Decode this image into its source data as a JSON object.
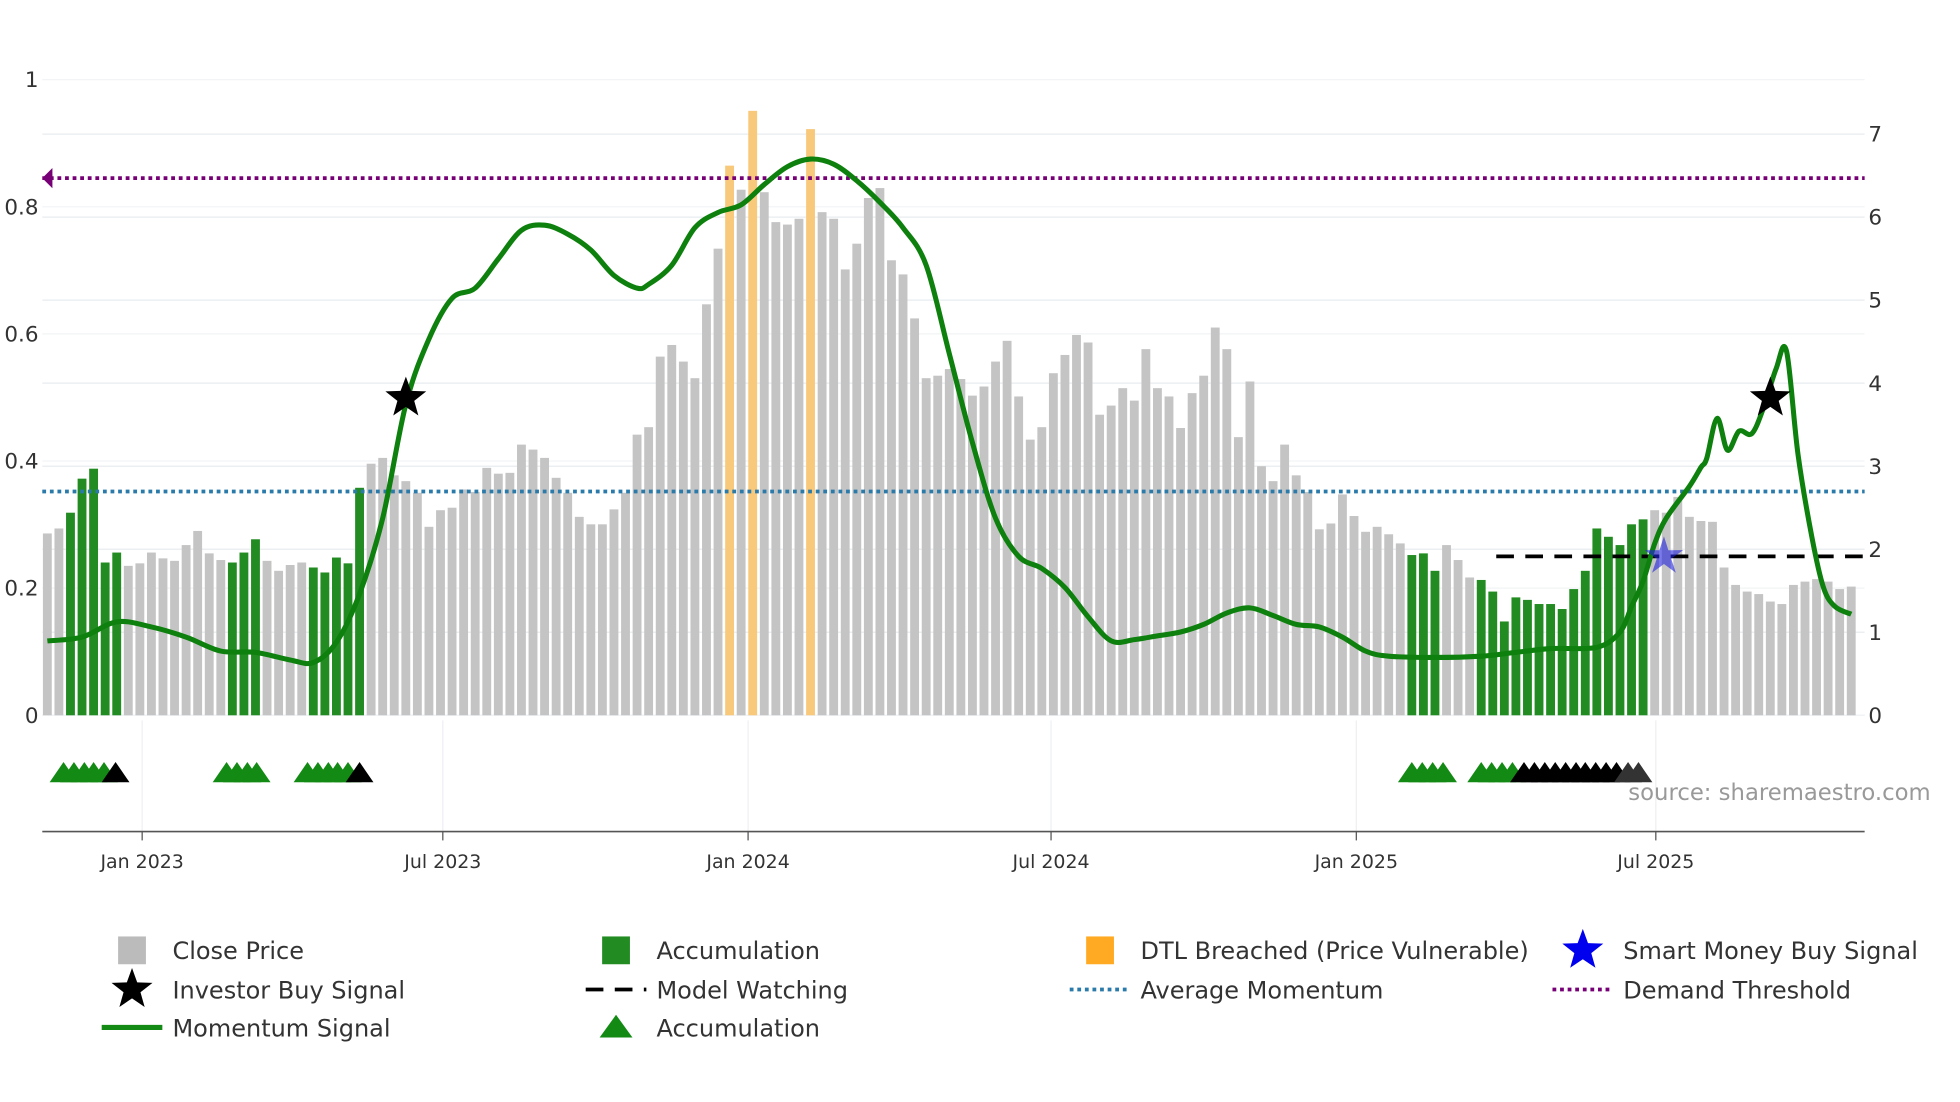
{
  "chart_data": {
    "type": "bar",
    "title": "",
    "x_unit": "week index (weekly bars, Nov 2022 – Nov 2025)",
    "x_ticks": [
      {
        "label": "Jan 2023",
        "week": 8.2
      },
      {
        "label": "Jul 2023",
        "week": 34.2
      },
      {
        "label": "Jan 2024",
        "week": 60.6
      },
      {
        "label": "Jul 2024",
        "week": 86.8
      },
      {
        "label": "Jan 2025",
        "week": 113.2
      },
      {
        "label": "Jul 2025",
        "week": 139.1
      }
    ],
    "left_axis": {
      "range": [
        0,
        1
      ],
      "ticks": [
        "0",
        "0.2",
        "0.4",
        "0.6",
        "0.8",
        "1"
      ],
      "values": [
        0,
        0.2,
        0.4,
        0.6,
        0.8,
        1
      ]
    },
    "right_axis": {
      "range": [
        0,
        7.65
      ],
      "ticks": [
        "0",
        "1",
        "2",
        "3",
        "4",
        "5",
        "6",
        "7"
      ],
      "values": [
        0,
        1,
        2,
        3,
        4,
        5,
        6,
        7
      ]
    },
    "close_price": [
      2.19,
      2.25,
      2.44,
      2.85,
      2.97,
      1.84,
      1.96,
      1.8,
      1.83,
      1.96,
      1.89,
      1.86,
      2.05,
      2.22,
      1.95,
      1.87,
      1.84,
      1.96,
      2.12,
      1.86,
      1.74,
      1.81,
      1.84,
      1.78,
      1.72,
      1.9,
      1.83,
      2.74,
      3.03,
      3.1,
      2.89,
      2.82,
      2.68,
      2.27,
      2.47,
      2.5,
      2.72,
      2.69,
      2.98,
      2.91,
      2.92,
      3.26,
      3.2,
      3.1,
      2.86,
      2.68,
      2.39,
      2.3,
      2.3,
      2.48,
      2.68,
      3.38,
      3.47,
      4.32,
      4.46,
      4.26,
      4.06,
      4.95,
      5.62,
      6.62,
      6.33,
      7.28,
      6.3,
      5.94,
      5.91,
      5.98,
      7.06,
      6.06,
      5.98,
      5.37,
      5.68,
      6.23,
      6.35,
      5.48,
      5.31,
      4.78,
      4.06,
      4.09,
      4.17,
      4.05,
      3.85,
      3.96,
      4.26,
      4.51,
      3.84,
      3.32,
      3.47,
      4.12,
      4.34,
      4.58,
      4.49,
      3.62,
      3.73,
      3.94,
      3.79,
      4.41,
      3.94,
      3.84,
      3.46,
      3.88,
      4.09,
      4.67,
      4.41,
      3.35,
      4.02,
      3.0,
      2.82,
      3.26,
      2.89,
      2.69,
      2.24,
      2.31,
      2.66,
      2.4,
      2.21,
      2.27,
      2.18,
      2.07,
      1.93,
      1.95,
      1.74,
      2.05,
      1.87,
      1.66,
      1.63,
      1.49,
      1.13,
      1.42,
      1.39,
      1.34,
      1.34,
      1.28,
      1.52,
      1.74,
      2.25,
      2.15,
      2.05,
      2.3,
      2.36,
      2.47,
      2.44,
      2.63,
      2.39,
      2.34,
      2.33,
      1.78,
      1.57,
      1.49,
      1.46,
      1.37,
      1.34,
      1.57,
      1.61,
      1.64,
      1.61,
      1.52,
      1.55
    ],
    "accumulation_weeks": [
      2,
      3,
      4,
      5,
      6,
      16,
      17,
      18,
      23,
      24,
      25,
      26,
      27,
      118,
      119,
      120,
      124,
      125,
      126,
      127,
      128,
      129,
      130,
      131,
      132,
      133,
      134,
      135,
      136,
      137,
      138
    ],
    "dtl_breached_weeks": [
      59,
      61,
      66
    ],
    "momentum_signal": [
      [
        0,
        0.117
      ],
      [
        3,
        0.123
      ],
      [
        6,
        0.147
      ],
      [
        9,
        0.139
      ],
      [
        12,
        0.123
      ],
      [
        15,
        0.101
      ],
      [
        18,
        0.099
      ],
      [
        21,
        0.087
      ],
      [
        23,
        0.083
      ],
      [
        25,
        0.115
      ],
      [
        27,
        0.191
      ],
      [
        29,
        0.31
      ],
      [
        31,
        0.489
      ],
      [
        33,
        0.592
      ],
      [
        35,
        0.656
      ],
      [
        37,
        0.672
      ],
      [
        39,
        0.718
      ],
      [
        41,
        0.763
      ],
      [
        43,
        0.771
      ],
      [
        45,
        0.757
      ],
      [
        47,
        0.732
      ],
      [
        49,
        0.692
      ],
      [
        51,
        0.672
      ],
      [
        52,
        0.678
      ],
      [
        54,
        0.708
      ],
      [
        56,
        0.767
      ],
      [
        58,
        0.791
      ],
      [
        60,
        0.803
      ],
      [
        62,
        0.835
      ],
      [
        64,
        0.863
      ],
      [
        66,
        0.875
      ],
      [
        68,
        0.867
      ],
      [
        70,
        0.841
      ],
      [
        72,
        0.807
      ],
      [
        74,
        0.767
      ],
      [
        76,
        0.708
      ],
      [
        78,
        0.569
      ],
      [
        80,
        0.429
      ],
      [
        82,
        0.31
      ],
      [
        84,
        0.25
      ],
      [
        86,
        0.231
      ],
      [
        88,
        0.201
      ],
      [
        90,
        0.155
      ],
      [
        92,
        0.117
      ],
      [
        94,
        0.119
      ],
      [
        96,
        0.125
      ],
      [
        98,
        0.131
      ],
      [
        100,
        0.143
      ],
      [
        102,
        0.161
      ],
      [
        104,
        0.169
      ],
      [
        106,
        0.157
      ],
      [
        108,
        0.143
      ],
      [
        110,
        0.139
      ],
      [
        112,
        0.123
      ],
      [
        114,
        0.101
      ],
      [
        116,
        0.093
      ],
      [
        120,
        0.091
      ],
      [
        124,
        0.093
      ],
      [
        127,
        0.099
      ],
      [
        130,
        0.105
      ],
      [
        134,
        0.107
      ],
      [
        136,
        0.131
      ],
      [
        137,
        0.171
      ],
      [
        138,
        0.211
      ],
      [
        139,
        0.27
      ],
      [
        140,
        0.31
      ],
      [
        142,
        0.36
      ],
      [
        143,
        0.39
      ],
      [
        143.5,
        0.404
      ],
      [
        144.4,
        0.467
      ],
      [
        145.3,
        0.417
      ],
      [
        146.3,
        0.447
      ],
      [
        147.4,
        0.443
      ],
      [
        148.4,
        0.483
      ],
      [
        149.5,
        0.545
      ],
      [
        150.4,
        0.573
      ],
      [
        151.4,
        0.41
      ],
      [
        152.6,
        0.28
      ],
      [
        153.6,
        0.201
      ],
      [
        154.6,
        0.171
      ],
      [
        156,
        0.159
      ]
    ],
    "average_momentum": 0.352,
    "demand_threshold": 0.845,
    "model_watching": {
      "from_week": 125.3,
      "value": 0.25
    },
    "investor_buy_signals": [
      [
        31,
        0.499
      ],
      [
        149,
        0.499
      ]
    ],
    "smart_money_buy_signals": [
      [
        139.8,
        0.25
      ]
    ],
    "accumulation_markers": {
      "green": [
        1.4,
        2.3,
        3.2,
        4.0,
        4.9,
        15.5,
        16.4,
        17.3,
        18.1,
        22.5,
        23.4,
        24.3,
        25.1,
        26.0,
        118.0,
        118.9,
        119.8,
        120.7,
        124.0,
        124.9,
        125.8,
        126.7
      ],
      "black": [
        5.9,
        27.0,
        127.7,
        128.6,
        129.5,
        130.4,
        131.3,
        132.2,
        133.0,
        133.9,
        134.8,
        135.7
      ],
      "gray": [
        136.7,
        137.6
      ]
    },
    "source": "source: sharemaestro.com",
    "legend_placement": "bottom",
    "legend": [
      {
        "label": "Close Price",
        "symbol": "bar",
        "color": "#bbbbbb"
      },
      {
        "label": "Investor Buy Signal",
        "symbol": "star",
        "color": "#000000"
      },
      {
        "label": "Momentum Signal",
        "symbol": "line",
        "color": "#138a13"
      },
      {
        "label": "Accumulation",
        "symbol": "bar",
        "color": "#228b22"
      },
      {
        "label": "Model Watching",
        "symbol": "dash",
        "color": "#000000"
      },
      {
        "label": "Accumulation",
        "symbol": "triangle",
        "color": "#138a13"
      },
      {
        "label": "DTL Breached (Price Vulnerable)",
        "symbol": "bar",
        "color": "#ffaa22"
      },
      {
        "label": "Average Momentum",
        "symbol": "dot",
        "color": "#2a7aaa"
      },
      {
        "label": "Smart Money Buy Signal",
        "symbol": "star",
        "color": "#0000ee"
      },
      {
        "label": "Demand Threshold",
        "symbol": "dot",
        "color": "#770077"
      }
    ],
    "colors": {
      "price": "#c4c4c4",
      "accum": "#228b22",
      "dtl": "#f8c97a",
      "momentum": "#0d800d",
      "avg": "#2a7aaa",
      "demand": "#770077",
      "smart": "#2222dd"
    }
  }
}
